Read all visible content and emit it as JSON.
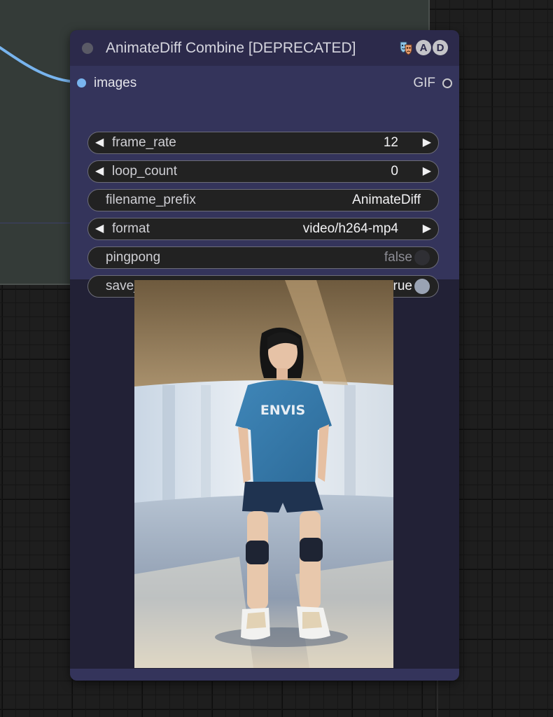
{
  "node": {
    "title": "AnimateDiff Combine [DEPRECATED]",
    "badges": [
      "A",
      "D"
    ],
    "mask_icon": "theater-mask-icon",
    "input": {
      "label": "images",
      "color": "#78b4ee"
    },
    "output": {
      "label": "GIF"
    },
    "widgets": {
      "frame_rate": {
        "label": "frame_rate",
        "value": "12"
      },
      "loop_count": {
        "label": "loop_count",
        "value": "0"
      },
      "filename_prefix": {
        "label": "filename_prefix",
        "value": "AnimateDiff"
      },
      "format": {
        "label": "format",
        "value": "video/h264-mp4"
      },
      "pingpong": {
        "label": "pingpong",
        "value": "false"
      },
      "save_image": {
        "label": "save_image",
        "value": "true"
      }
    },
    "preview": {
      "shirt_text": "ENVIS"
    }
  },
  "colors": {
    "header": "#2c2a4b",
    "body": "#34345b",
    "widget_bg": "#222222",
    "wire": "#78b4ee"
  }
}
